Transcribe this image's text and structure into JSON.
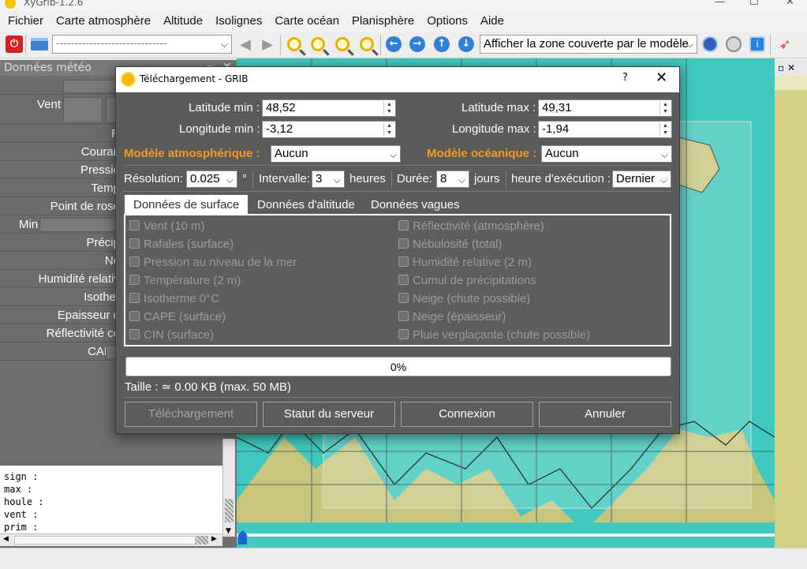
{
  "window": {
    "title": "XyGrib-1.2.6"
  },
  "menubar": {
    "items": [
      "Fichier",
      "Carte atmosphère",
      "Altitude",
      "Isolignes",
      "Carte océan",
      "Planisphère",
      "Options",
      "Aide"
    ]
  },
  "toolbar": {
    "date_combo": "------------------------------",
    "zone_combo": "Afficher la zone couverte par le modèle"
  },
  "left_panel": {
    "title": "Données météo",
    "rows": [
      "",
      "Vent",
      "R",
      "Couran",
      "Pressio",
      "Temp",
      "Point de rosé",
      "Min",
      "Précip",
      "Né",
      "Humidité relativ",
      "Isother",
      "Epaisseur d",
      "Réflectivité co",
      "CAPE"
    ],
    "text_lines": [
      "sign :",
      "max :",
      "houle :",
      "vent :",
      "prim :"
    ]
  },
  "colors": {
    "accent_orange": "#f29a1f",
    "dialog_bg": "#5b5b5b",
    "sea": "#40c9be",
    "land": "#c8c67d"
  },
  "dialog": {
    "title": "Téléchargement - GRIB",
    "help": "?",
    "close": "✕",
    "lat_min_label": "Latitude min :",
    "lat_min": "48,52",
    "lat_max_label": "Latitude max :",
    "lat_max": "49,31",
    "lon_min_label": "Longitude min :",
    "lon_min": "-3,12",
    "lon_max_label": "Longitude max :",
    "lon_max": "-1,94",
    "atmo_model_label": "Modèle atmosphérique :",
    "atmo_model": "Aucun",
    "ocean_model_label": "Modèle océanique :",
    "ocean_model": "Aucun",
    "resolution_label": "Résolution:",
    "resolution": "0.025",
    "degree": "°",
    "interval_label": "Intervalle:",
    "interval": "3",
    "hours_unit": "heures",
    "duration_label": "Durée:",
    "duration": "8",
    "days_unit": "jours",
    "run_label": "heure d'exécution :",
    "run": "Dernier",
    "tabs": [
      "Données de surface",
      "Données d'altitude",
      "Données vagues"
    ],
    "left_checks": [
      "Vent (10 m)",
      "Rafales (surface)",
      "Pression au niveau de la mer",
      "Température (2 m)",
      "Isotherme 0°C",
      "CAPE (surface)",
      "CIN (surface)"
    ],
    "right_checks": [
      "Réflectivité (atmosphère)",
      "Nébulosité (total)",
      "Humidité relative (2 m)",
      "Cumul de précipitations",
      "Neige (chute possible)",
      "Neige (épaisseur)",
      "Pluie verglaçante (chute possible)"
    ],
    "progress": "0%",
    "progress_value": 0,
    "size_text": "Taille : ≃ 0.00 KB (max. 50 MB)",
    "buttons": {
      "download": "Téléchargement",
      "server_status": "Statut du serveur",
      "connect": "Connexion",
      "cancel": "Annuler"
    }
  }
}
